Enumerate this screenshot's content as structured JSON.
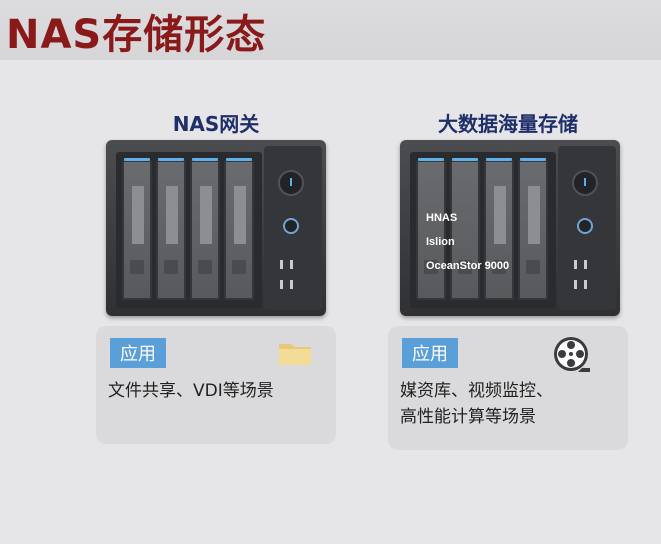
{
  "slide": {
    "title": "NAS存储形态"
  },
  "left_panel": {
    "heading": "NAS网关",
    "app_tag": "应用",
    "app_text": "文件共享、VDI等场景",
    "icon": "folder-icon"
  },
  "right_panel": {
    "heading": "大数据海量存储",
    "device_labels": [
      "HNAS",
      "Islion",
      "OceanStor 9000"
    ],
    "app_tag": "应用",
    "app_text": "媒资库、视频监控、\n高性能计算等场景",
    "icon": "film-reel-icon"
  },
  "colors": {
    "title": "#8a1a1a",
    "heading": "#1f2f6a",
    "tag": "#5a9fd8"
  }
}
